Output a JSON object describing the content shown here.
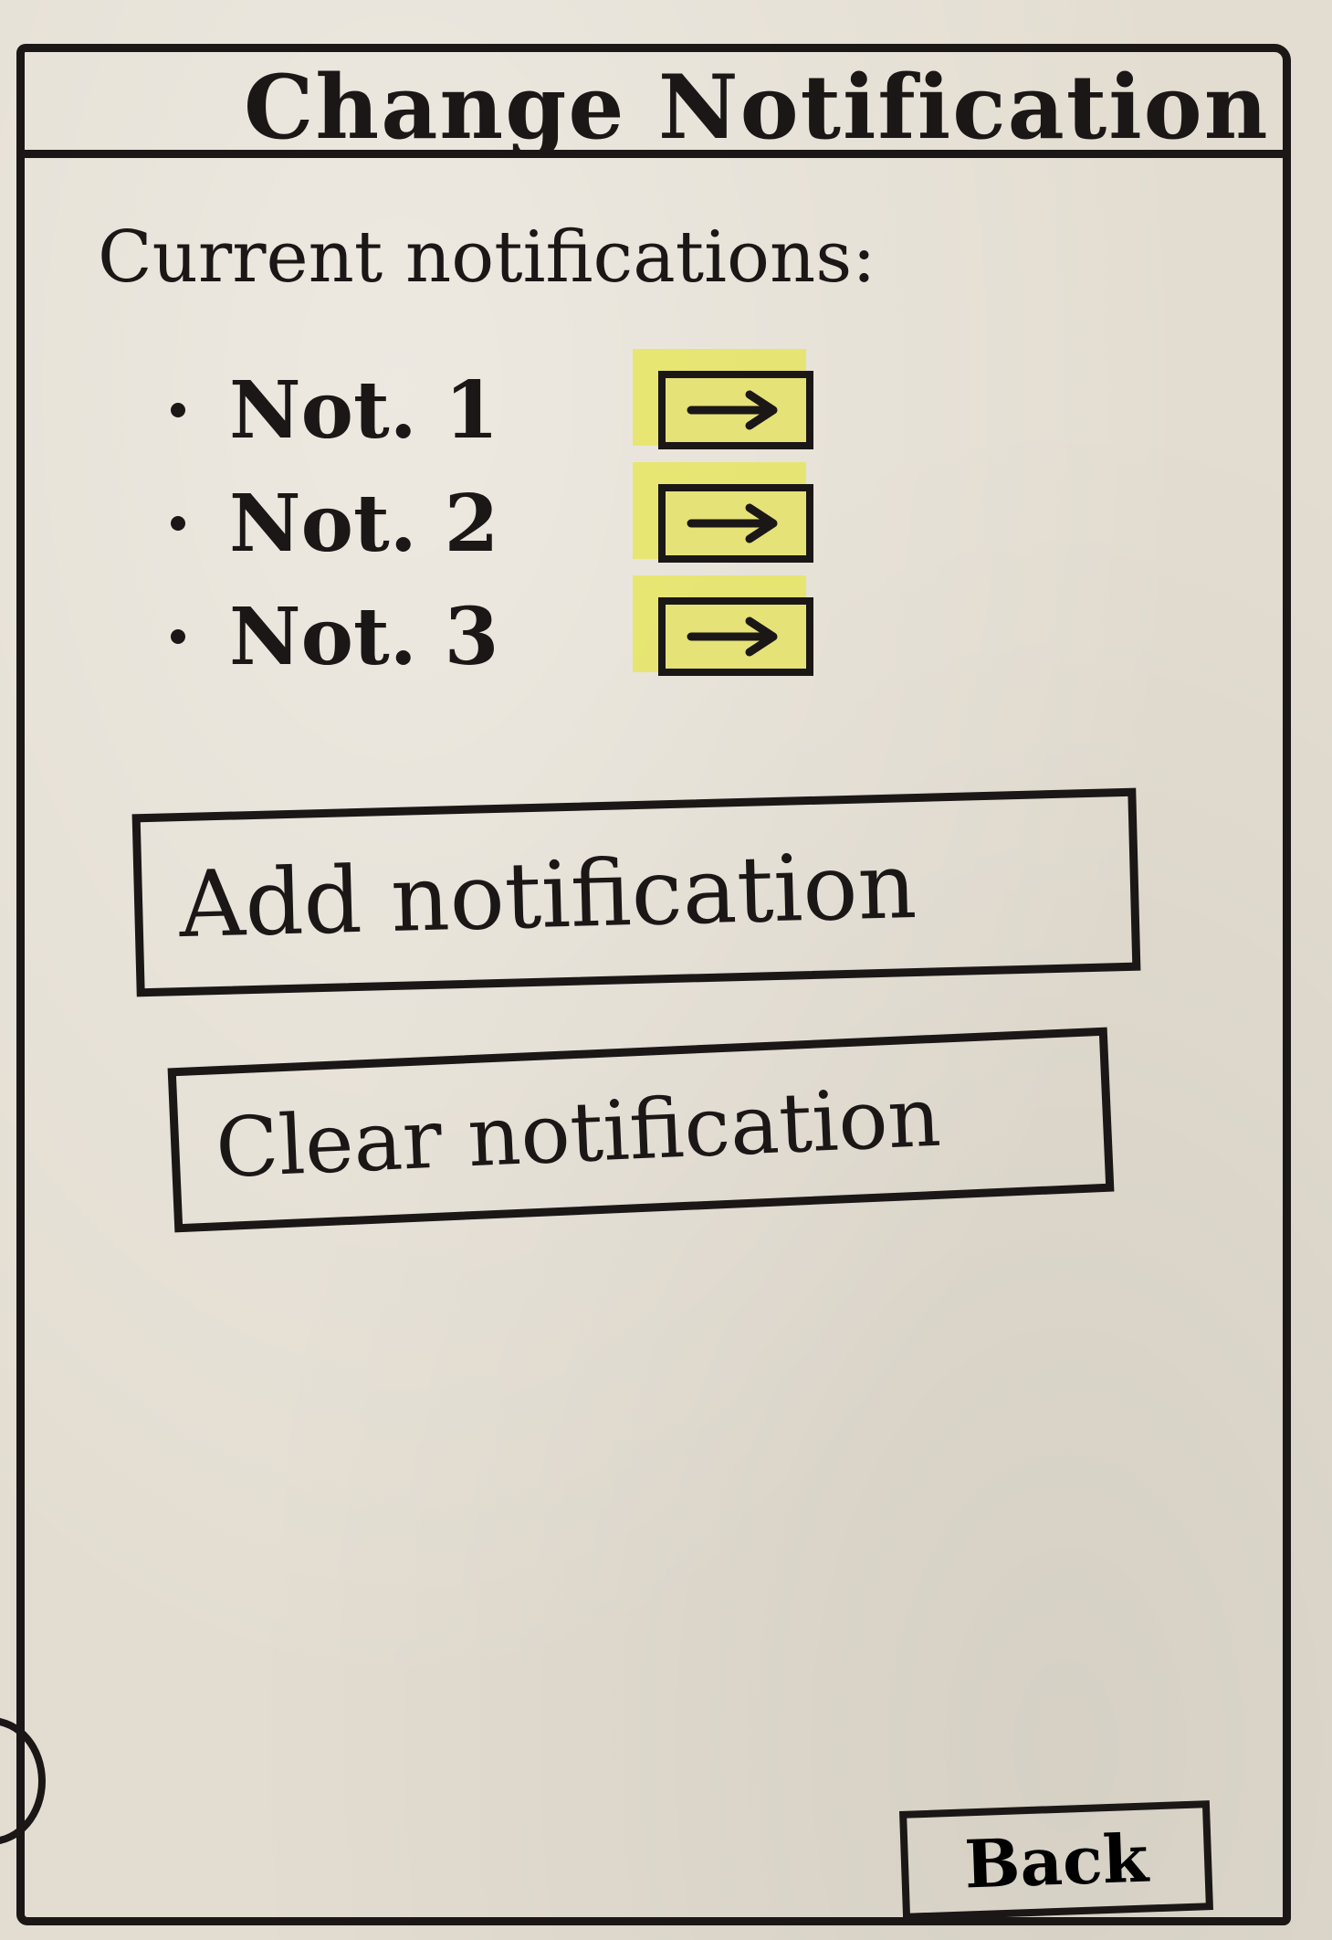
{
  "title": "Change Notification",
  "section_label": "Current notifications:",
  "notifications": [
    {
      "label": "Not. 1",
      "action_icon": "arrow-right-icon"
    },
    {
      "label": "Not. 2",
      "action_icon": "arrow-right-icon"
    },
    {
      "label": "Not. 3",
      "action_icon": "arrow-right-icon"
    }
  ],
  "buttons": {
    "add_label": "Add notification",
    "clear_label": "Clear notification",
    "back_label": "Back"
  },
  "colors": {
    "ink": "#1b1716",
    "paper": "#e3ddd1",
    "highlight": "#e5e278"
  }
}
